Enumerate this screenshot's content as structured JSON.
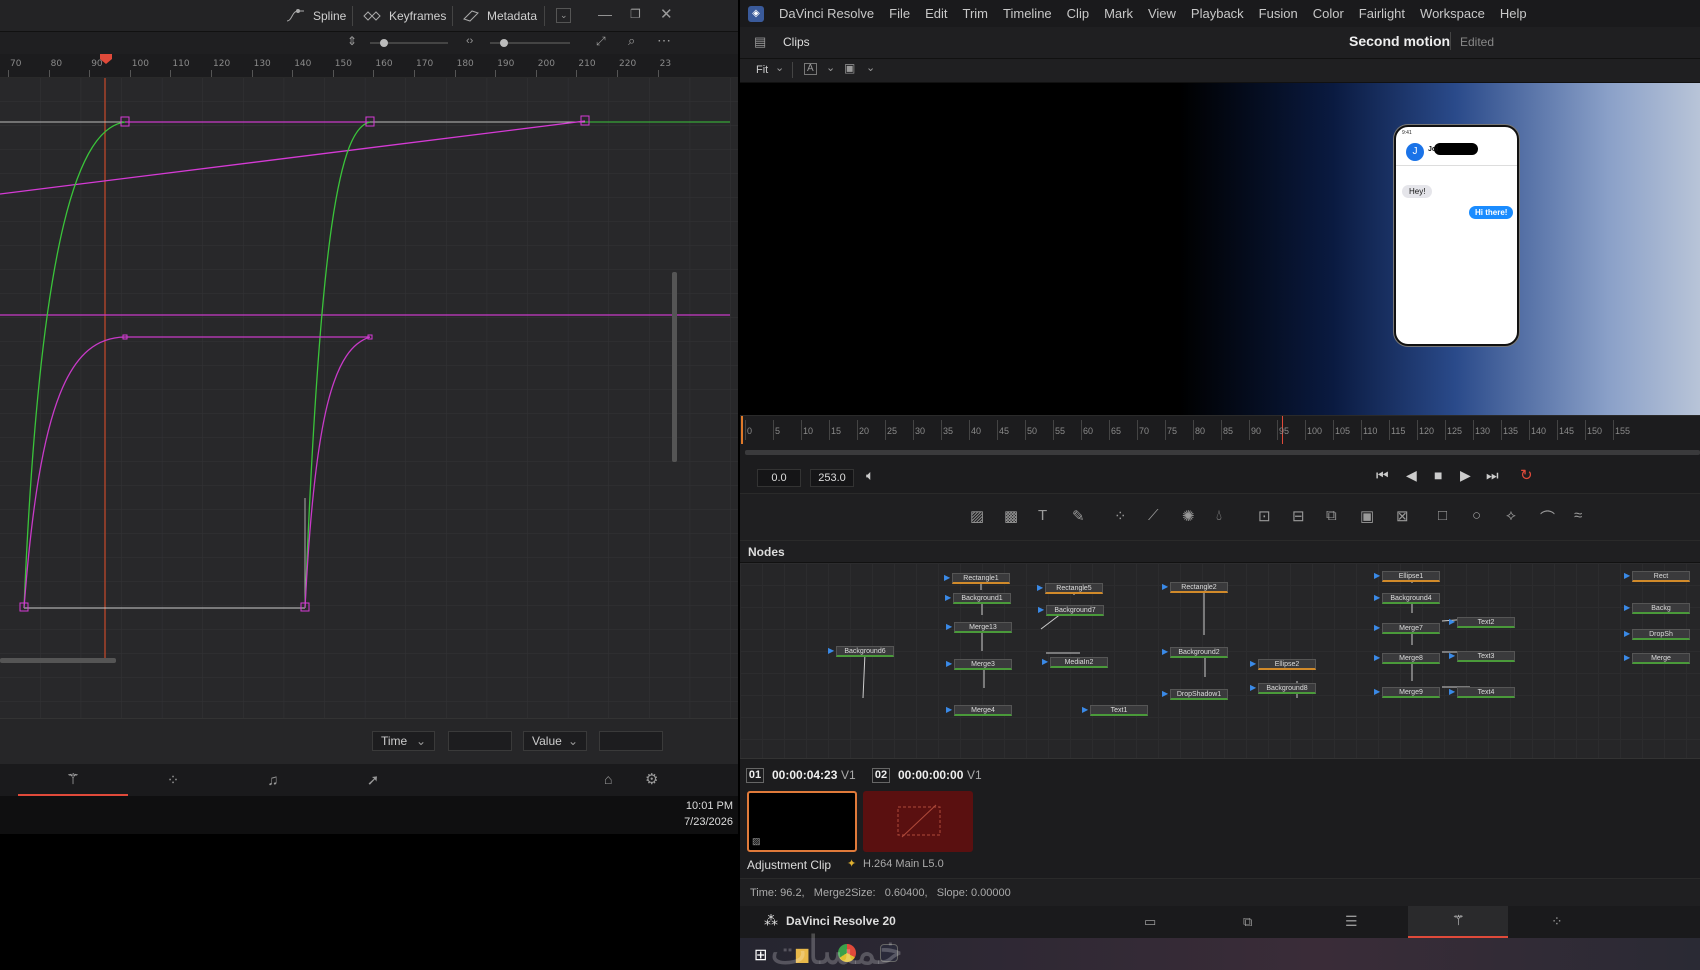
{
  "left_panel": {
    "tabs": [
      {
        "label": "Spline",
        "icon": "spline-icon"
      },
      {
        "label": "Keyframes",
        "icon": "keyframes-icon"
      },
      {
        "label": "Metadata",
        "icon": "metadata-icon"
      }
    ],
    "ruler_ticks": [
      "70",
      "80",
      "90",
      "100",
      "110",
      "120",
      "130",
      "140",
      "150",
      "160",
      "170",
      "180",
      "190",
      "200",
      "210",
      "220",
      "23"
    ],
    "playhead_frame": "96",
    "footer": {
      "time_select": "Time",
      "time_value": "",
      "value_select": "Value",
      "value_value": ""
    },
    "pages": [
      "fusion-page-icon",
      "effects-icon",
      "music-icon",
      "deliver-icon"
    ],
    "home_icon": "home-icon",
    "settings_icon": "gear-icon",
    "clock": {
      "time": "10:01 PM",
      "date": "7/23/2026"
    }
  },
  "right_panel": {
    "app_name": "DaVinci Resolve",
    "menu": [
      "File",
      "Edit",
      "Trim",
      "Timeline",
      "Clip",
      "Mark",
      "View",
      "Playback",
      "Fusion",
      "Color",
      "Fairlight",
      "Workspace",
      "Help"
    ],
    "viewer_header": {
      "clips_label": "Clips",
      "project_title": "Second motion",
      "status": "Edited"
    },
    "viewer_toolbar": {
      "zoom": "Fit"
    },
    "phone": {
      "time": "9:41",
      "contact_initial": "J",
      "contact_name": "Jol",
      "msg_in": "Hey!",
      "msg_out": "Hi there!"
    },
    "timeline_ticks": [
      "0",
      "5",
      "10",
      "15",
      "20",
      "25",
      "30",
      "35",
      "40",
      "45",
      "50",
      "55",
      "60",
      "65",
      "70",
      "75",
      "80",
      "85",
      "90",
      "95",
      "100",
      "105",
      "110",
      "115",
      "120",
      "125",
      "130",
      "135",
      "140",
      "145",
      "150",
      "155"
    ],
    "transport": {
      "in_value": "0.0",
      "out_value": "253.0"
    },
    "nodes_title": "Nodes",
    "nodes": [
      {
        "name": "Rectangle1"
      },
      {
        "name": "Background1"
      },
      {
        "name": "Rectangle5"
      },
      {
        "name": "Background7"
      },
      {
        "name": "Merge13"
      },
      {
        "name": "Background6"
      },
      {
        "name": "Merge3"
      },
      {
        "name": "MediaIn2"
      },
      {
        "name": "Merge4"
      },
      {
        "name": "Rectangle2"
      },
      {
        "name": "Background2"
      },
      {
        "name": "DropShadow1"
      },
      {
        "name": "Ellipse2"
      },
      {
        "name": "Background8"
      },
      {
        "name": "Text1"
      },
      {
        "name": "Ellipse1"
      },
      {
        "name": "Background4"
      },
      {
        "name": "Merge7"
      },
      {
        "name": "Text2"
      },
      {
        "name": "Merge8"
      },
      {
        "name": "Text3"
      },
      {
        "name": "Merge9"
      },
      {
        "name": "Text4"
      },
      {
        "name": "Rect"
      },
      {
        "name": "Backg"
      },
      {
        "name": "DropSh"
      },
      {
        "name": "Merge"
      }
    ],
    "clips": [
      {
        "index": "01",
        "timecode": "00:00:04:23",
        "track": "V1",
        "label": "Adjustment Clip"
      },
      {
        "index": "02",
        "timecode": "00:00:00:00",
        "track": "V1",
        "label": "H.264 Main L5.0"
      }
    ],
    "status": {
      "time": "Time: 96.2,",
      "param": "Merge2Size:",
      "value": "0.60400,",
      "slope": "Slope: 0.00000"
    },
    "branding": "DaVinci Resolve 20",
    "watermark": "خمسات"
  }
}
